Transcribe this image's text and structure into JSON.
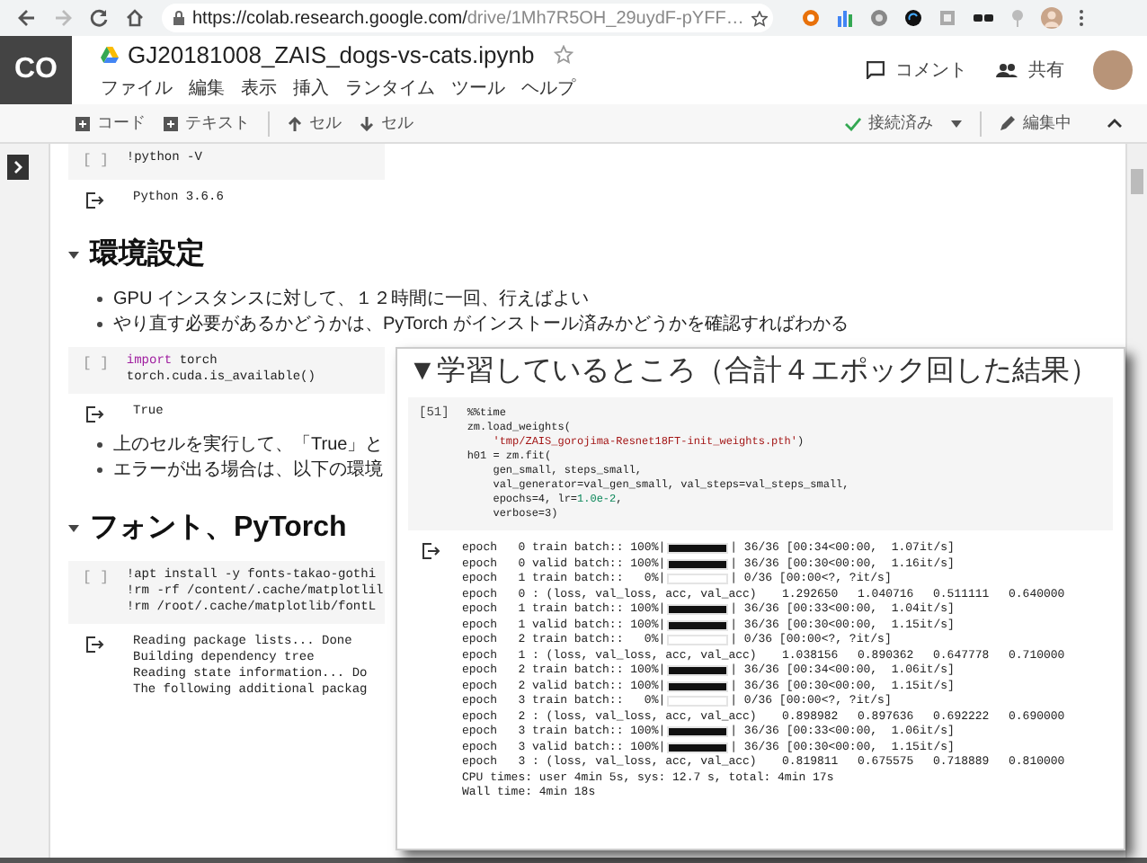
{
  "browser": {
    "url_host": "https://colab.research.google.com/",
    "url_path": "drive/1Mh7R5OH_29uydF-pYFF…"
  },
  "header": {
    "logo": "CO",
    "title": "GJ20181008_ZAIS_dogs-vs-cats.ipynb",
    "menu": [
      "ファイル",
      "編集",
      "表示",
      "挿入",
      "ランタイム",
      "ツール",
      "ヘルプ"
    ],
    "comment": "コメント",
    "share": "共有"
  },
  "toolbar": {
    "add_code": "コード",
    "add_text": "テキスト",
    "cell_up": "セル",
    "cell_down": "セル",
    "connection": "接続済み",
    "edit_mode": "編集中"
  },
  "notebook": [
    {
      "kind": "code",
      "prompt": "[ ]",
      "lines": [
        [
          {
            "text": "!python -V",
            "kind": "plain"
          }
        ]
      ]
    },
    {
      "kind": "output",
      "lines": [
        "Python 3.6.6"
      ]
    },
    {
      "kind": "heading",
      "text": "環境設定"
    },
    {
      "kind": "bullets",
      "items": [
        "GPU インスタンスに対して、１２時間に一回、行えばよい",
        "やり直す必要があるかどうかは、PyTorch がインストール済みかどうかを確認すればわかる"
      ]
    },
    {
      "kind": "code",
      "prompt": "[ ]",
      "lines": [
        [
          {
            "text": "import",
            "kind": "keyword"
          },
          {
            "text": " torch",
            "kind": "plain"
          }
        ],
        [
          {
            "text": "torch.cuda.is_available()",
            "kind": "plain"
          }
        ]
      ]
    },
    {
      "kind": "output",
      "lines": [
        "True"
      ]
    },
    {
      "kind": "bullets",
      "items": [
        "上のセルを実行して、「True」と",
        "エラーが出る場合は、以下の環境"
      ]
    },
    {
      "kind": "heading",
      "text": "フォント、PyTorch"
    },
    {
      "kind": "code",
      "prompt": "[ ]",
      "lines": [
        [
          {
            "text": "!apt install -y fonts-takao-gothi",
            "kind": "plain"
          }
        ],
        [
          {
            "text": "!rm -rf /content/.cache/matplotlil",
            "kind": "plain"
          }
        ],
        [
          {
            "text": "!rm /root/.cache/matplotlib/fontL",
            "kind": "plain"
          }
        ]
      ]
    },
    {
      "kind": "output",
      "lines": [
        "Reading package lists... Done",
        "Building dependency tree",
        "Reading state information... Do",
        "The following additional packag"
      ]
    }
  ],
  "callout": {
    "title": "▼学習しているところ（合計４エポック回した結果）",
    "prompt": "[51]",
    "code": [
      [
        {
          "text": "%%time",
          "kind": "plain"
        }
      ],
      [
        {
          "text": "zm.load_weights(",
          "kind": "plain"
        }
      ],
      [
        {
          "text": "    'tmp/ZAIS_gorojima-Resnet18FT-init_weights.pth'",
          "kind": "string"
        },
        {
          "text": ")",
          "kind": "plain"
        }
      ],
      [
        {
          "text": "h01 = zm.fit(",
          "kind": "plain"
        }
      ],
      [
        {
          "text": "    gen_small, steps_small,",
          "kind": "plain"
        }
      ],
      [
        {
          "text": "    val_generator=val_gen_small, val_steps=val_steps_small,",
          "kind": "plain"
        }
      ],
      [
        {
          "text": "    epochs=4, lr=",
          "kind": "plain"
        },
        {
          "text": "1.0e-2",
          "kind": "number"
        },
        {
          "text": ",",
          "kind": "plain"
        }
      ],
      [
        {
          "text": "    verbose=3)",
          "kind": "plain"
        }
      ]
    ],
    "output": [
      {
        "kind": "progress",
        "label": "epoch   0 train batch:: 100%|",
        "level": 1,
        "reading": "| 36/36 [00:34<00:00,  1.07it/s]"
      },
      {
        "kind": "progress",
        "label": "epoch   0 valid batch:: 100%|",
        "level": 1,
        "reading": "| 36/36 [00:30<00:00,  1.16it/s]"
      },
      {
        "kind": "progress",
        "label": "epoch   1 train batch::   0%|",
        "level": 0,
        "reading": "| 0/36 [00:00<?, ?it/s]"
      },
      {
        "kind": "metrics",
        "label": "epoch   0 : (loss, val_loss, acc, val_acc)",
        "values": [
          "1.292650",
          "1.040716",
          "0.511111",
          "0.640000"
        ]
      },
      {
        "kind": "progress",
        "label": "epoch   1 train batch:: 100%|",
        "level": 1,
        "reading": "| 36/36 [00:33<00:00,  1.04it/s]"
      },
      {
        "kind": "progress",
        "label": "epoch   1 valid batch:: 100%|",
        "level": 1,
        "reading": "| 36/36 [00:30<00:00,  1.15it/s]"
      },
      {
        "kind": "progress",
        "label": "epoch   2 train batch::   0%|",
        "level": 0,
        "reading": "| 0/36 [00:00<?, ?it/s]"
      },
      {
        "kind": "metrics",
        "label": "epoch   1 : (loss, val_loss, acc, val_acc)",
        "values": [
          "1.038156",
          "0.890362",
          "0.647778",
          "0.710000"
        ]
      },
      {
        "kind": "progress",
        "label": "epoch   2 train batch:: 100%|",
        "level": 1,
        "reading": "| 36/36 [00:34<00:00,  1.06it/s]"
      },
      {
        "kind": "progress",
        "label": "epoch   2 valid batch:: 100%|",
        "level": 1,
        "reading": "| 36/36 [00:30<00:00,  1.15it/s]"
      },
      {
        "kind": "progress",
        "label": "epoch   3 train batch::   0%|",
        "level": 0,
        "reading": "| 0/36 [00:00<?, ?it/s]"
      },
      {
        "kind": "metrics",
        "label": "epoch   2 : (loss, val_loss, acc, val_acc)",
        "values": [
          "0.898982",
          "0.897636",
          "0.692222",
          "0.690000"
        ]
      },
      {
        "kind": "progress",
        "label": "epoch   3 train batch:: 100%|",
        "level": 1,
        "reading": "| 36/36 [00:33<00:00,  1.06it/s]"
      },
      {
        "kind": "progress",
        "label": "epoch   3 valid batch:: 100%|",
        "level": 1,
        "reading": "| 36/36 [00:30<00:00,  1.15it/s]"
      },
      {
        "kind": "metrics",
        "label": "epoch   3 : (loss, val_loss, acc, val_acc)",
        "values": [
          "0.819811",
          "0.675575",
          "0.718889",
          "0.810000"
        ]
      },
      {
        "kind": "text",
        "text": "CPU times: user 4min 5s, sys: 12.7 s, total: 4min 17s"
      },
      {
        "kind": "text",
        "text": "Wall time: 4min 18s"
      }
    ]
  }
}
